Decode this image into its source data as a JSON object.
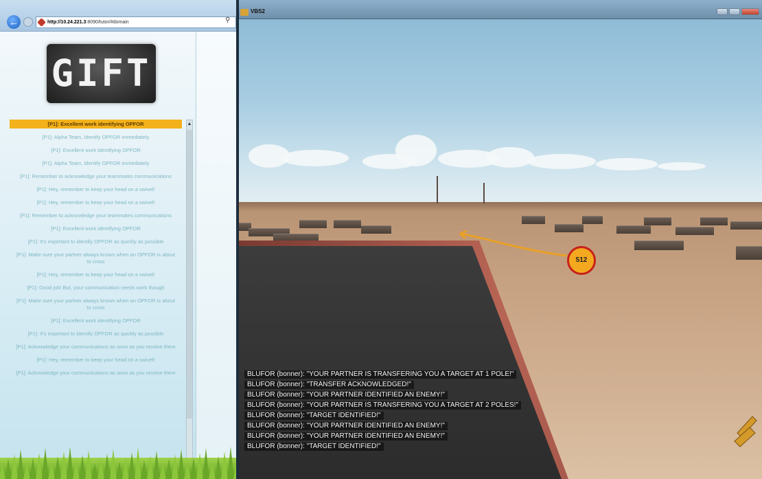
{
  "browser": {
    "url_host": "http://10.24.221.3",
    "url_rest": ":8090/tutor/#domain",
    "logo_text": "GIFT",
    "feedback_items": [
      {
        "text": "[P1]: Excellent work identifying OPFOR",
        "active": true
      },
      {
        "text": "[P1]: Alpha Team, Identify OPFOR immediately",
        "active": false
      },
      {
        "text": "[P1]: Excellent work identifying OPFOR",
        "active": false
      },
      {
        "text": "[P1]: Alpha Team, Identify OPFOR immediately",
        "active": false
      },
      {
        "text": "[P1]: Remember to acknowledge your teammates communications",
        "active": false
      },
      {
        "text": "[P1]: Hey, remember to keep your head on a swivel!",
        "active": false
      },
      {
        "text": "[P1]: Hey, remember to keep your head on a swivel!",
        "active": false
      },
      {
        "text": "[P1]: Remember to acknowledge your teammates communications",
        "active": false
      },
      {
        "text": "[P1]: Excellent work identifying OPFOR",
        "active": false
      },
      {
        "text": "[P1]: It's important to identify OPFOR as quickly as possible",
        "active": false
      },
      {
        "text": "[P1]: Make sure your partner always knows when an OPFOR is about to cross",
        "active": false
      },
      {
        "text": "[P1]: Hey, remember to keep your head on a swivel!",
        "active": false
      },
      {
        "text": "[P1]: Good job! But, your communication needs work though",
        "active": false
      },
      {
        "text": "[P1]: Make sure your partner always knows when an OPFOR is about to cross",
        "active": false
      },
      {
        "text": "[P1]: Excellent work identifying OPFOR",
        "active": false
      },
      {
        "text": "[P1]: It's important to identify OPFOR as quickly as possible",
        "active": false
      },
      {
        "text": "[P1]: Acknowledge your communications as soon as you receive them",
        "active": false
      },
      {
        "text": "[P1]: Hey, remember to keep your head on a swivel!",
        "active": false
      },
      {
        "text": "[P1]: Acknowledge your communications as soon as you receive them",
        "active": false
      }
    ]
  },
  "game": {
    "window_title": "VBS2",
    "target_marker": "512",
    "chat_log": [
      "BLUFOR (bonner): \"YOUR PARTNER IS TRANSFERING YOU A TARGET AT 1 POLE!\"",
      "BLUFOR (bonner): \"TRANSFER ACKNOWLEDGED!\"",
      "BLUFOR (bonner): \"YOUR PARTNER IDENTIFIED AN ENEMY!\"",
      "BLUFOR (bonner): \"YOUR PARTNER IS TRANSFERING YOU A TARGET AT 2 POLES!\"",
      "BLUFOR (bonner): \"TARGET IDENTIFIED!\"",
      "BLUFOR (bonner): \"YOUR PARTNER IDENTIFIED AN ENEMY!\"",
      "BLUFOR (bonner): \"YOUR PARTNER IDENTIFIED AN ENEMY!\"",
      "BLUFOR (bonner): \"TARGET IDENTIFIED!\""
    ]
  },
  "colors": {
    "active_feedback": "#f3b11b",
    "marker_fill": "#f3a81f",
    "marker_ring": "#c6201a",
    "path_line": "#e8a028"
  }
}
